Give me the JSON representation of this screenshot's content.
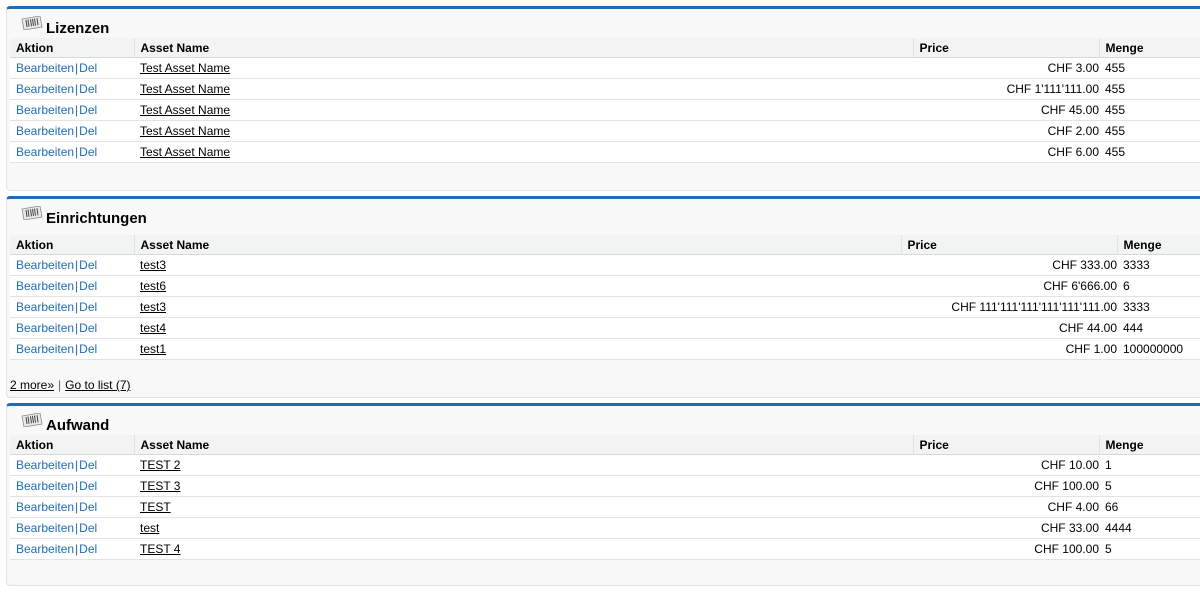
{
  "sections": [
    {
      "title": "Lizenzen",
      "columns": [
        "Aktion",
        "Asset Name",
        "Price",
        "Menge"
      ],
      "action_edit": "Bearbeiten",
      "action_sep": "|",
      "action_del": "Del",
      "rows": [
        {
          "name": "Test Asset Name",
          "price": "CHF 3.00",
          "qty": "455"
        },
        {
          "name": "Test Asset Name",
          "price": "CHF 1'111'111.00",
          "qty": "455"
        },
        {
          "name": "Test Asset Name",
          "price": "CHF 45.00",
          "qty": "455"
        },
        {
          "name": "Test Asset Name",
          "price": "CHF 2.00",
          "qty": "455"
        },
        {
          "name": "Test Asset Name",
          "price": "CHF 6.00",
          "qty": "455"
        }
      ]
    },
    {
      "title": "Einrichtungen",
      "columns": [
        "Aktion",
        "Asset Name",
        "Price",
        "Menge"
      ],
      "action_edit": "Bearbeiten",
      "action_sep": "|",
      "action_del": "Del",
      "rows": [
        {
          "name": "test3",
          "price": "CHF 333.00",
          "qty": "3333"
        },
        {
          "name": "test6",
          "price": "CHF 6'666.00",
          "qty": "6"
        },
        {
          "name": "test3",
          "price": "CHF 111'111'111'111'111'111.00",
          "qty": "3333"
        },
        {
          "name": "test4",
          "price": "CHF 44.00",
          "qty": "444"
        },
        {
          "name": "test1",
          "price": "CHF 1.00",
          "qty": "100000000"
        }
      ]
    },
    {
      "title": "Aufwand",
      "columns": [
        "Aktion",
        "Asset Name",
        "Price",
        "Menge"
      ],
      "action_edit": "Bearbeiten",
      "action_sep": "|",
      "action_del": "Del",
      "rows": [
        {
          "name": "TEST 2",
          "price": "CHF 10.00",
          "qty": "1"
        },
        {
          "name": "TEST 3",
          "price": "CHF 100.00",
          "qty": "5"
        },
        {
          "name": "TEST",
          "price": "CHF 4.00",
          "qty": "66"
        },
        {
          "name": "test",
          "price": "CHF 33.00",
          "qty": "4444"
        },
        {
          "name": "TEST 4",
          "price": "CHF 100.00",
          "qty": "5"
        }
      ]
    }
  ],
  "einrichtungen_footer": {
    "more_link": "2 more»",
    "separator": "|",
    "list_link": "Go to list (7)"
  },
  "colors": {
    "accent": "#1f6db5",
    "panel_bg": "#f8f8f8",
    "header_bg": "#f2f3f3"
  },
  "icons": {
    "section_icon": "barcode-icon"
  }
}
